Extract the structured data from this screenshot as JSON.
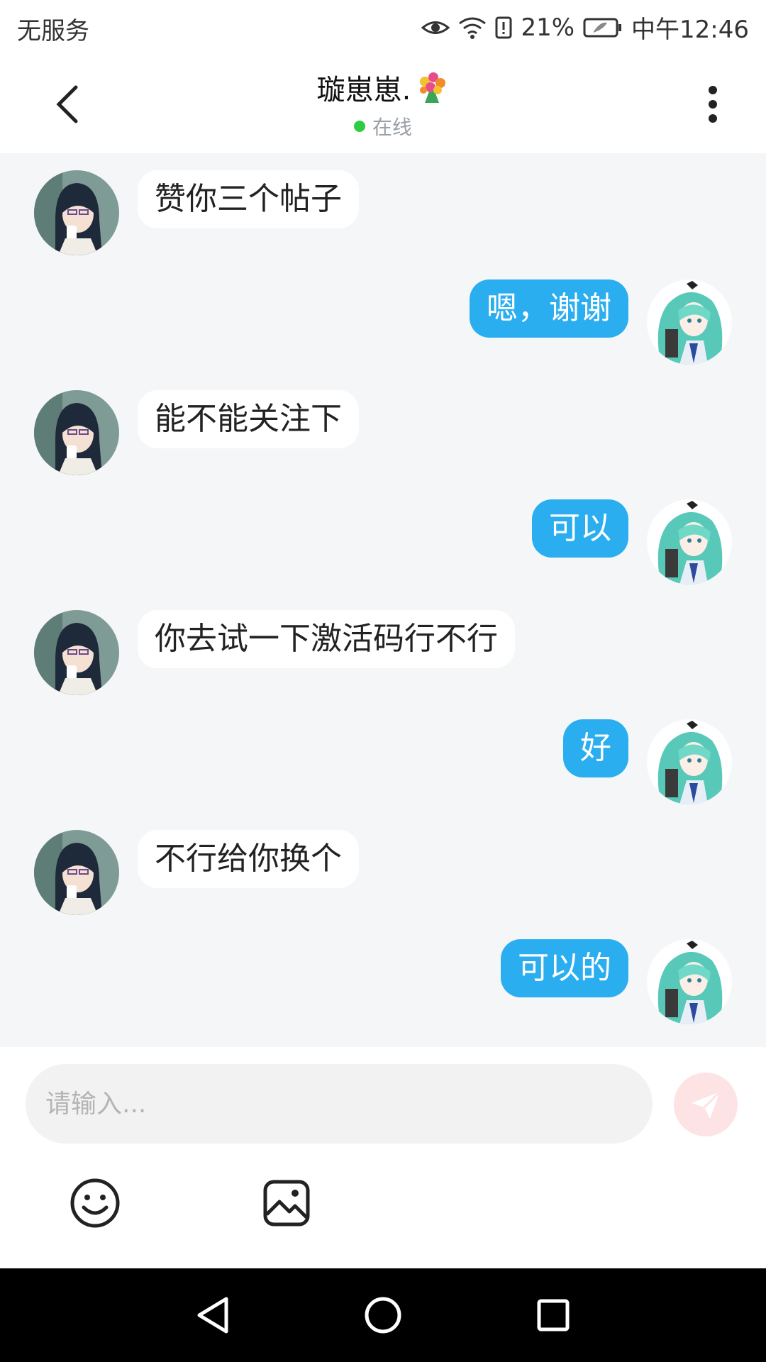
{
  "status_bar": {
    "carrier": "无服务",
    "battery": "21%",
    "time": "中午12:46"
  },
  "header": {
    "title": "璇崽崽.",
    "status": "在线"
  },
  "messages": [
    {
      "side": "in",
      "text": "赞你三个帖子"
    },
    {
      "side": "out",
      "text": "嗯，谢谢"
    },
    {
      "side": "in",
      "text": "能不能关注下"
    },
    {
      "side": "out",
      "text": "可以"
    },
    {
      "side": "in",
      "text": "你去试一下激活码行不行"
    },
    {
      "side": "out",
      "text": "好"
    },
    {
      "side": "in",
      "text": "不行给你换个"
    },
    {
      "side": "out",
      "text": "可以的"
    }
  ],
  "input": {
    "placeholder": "请输入..."
  },
  "colors": {
    "out_bubble": "#2aaef0",
    "chat_bg": "#f4f6f8",
    "online": "#2ecc40"
  }
}
